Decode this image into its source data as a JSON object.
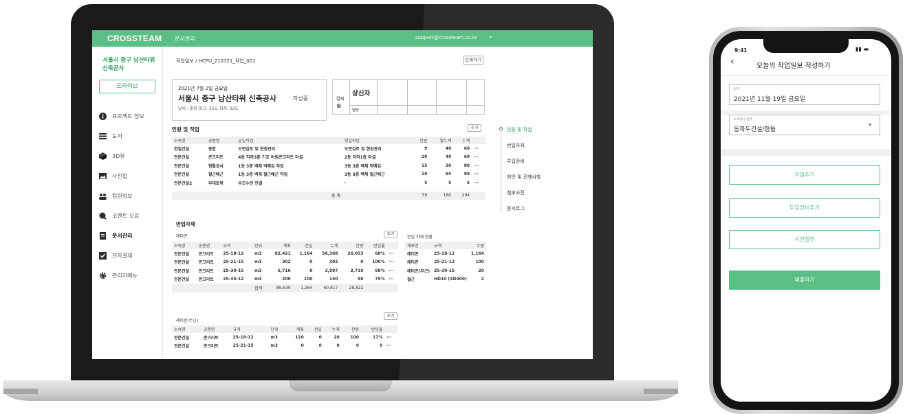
{
  "app": {
    "brand": "CROSSTEAM",
    "top_menu": "문서관리",
    "user_email": "support@crossteam.co.kr"
  },
  "sidebar": {
    "project_name": "서울시 중구 남산타워 신축공사",
    "drive_button": "드라이브",
    "items": [
      {
        "label": "프로젝트 정보",
        "icon": "info-icon"
      },
      {
        "label": "도서",
        "icon": "list-icon"
      },
      {
        "label": "3D뷰",
        "icon": "cube-icon"
      },
      {
        "label": "사진첩",
        "icon": "image-icon"
      },
      {
        "label": "팀원정보",
        "icon": "team-icon"
      },
      {
        "label": "코멘트 모음",
        "icon": "comment-icon"
      },
      {
        "label": "문서관리",
        "icon": "document-icon"
      },
      {
        "label": "전자결재",
        "icon": "approval-icon"
      },
      {
        "label": "관리자메뉴",
        "icon": "gear-icon"
      }
    ]
  },
  "main": {
    "breadcrumb": "작업일보 / HCPU_210321_작업_001",
    "print_button": "인쇄하기",
    "report": {
      "date": "2021년 7월 2일 금요일",
      "title": "서울시 중구 남산타워 신축공사",
      "status": "작성중",
      "weather": "날씨 : 맑음 최고: 35도 최저: 22도"
    },
    "approval": {
      "label": "결재",
      "submitter": "상신자",
      "assignee": "담당"
    },
    "workforce": {
      "title": "인원 및 작업",
      "add_button": "추가",
      "headers": [
        "소속명",
        "공종명",
        "금일작업",
        "명일작업",
        "인원",
        "월누계",
        "누계"
      ],
      "rows": [
        [
          "한일건설",
          "종합",
          "도면검토 및 현장관리",
          "도면검토 및 현장관리",
          "9",
          "40",
          "60"
        ],
        [
          "전문건설",
          "콘크리트",
          "4동 지하3층 기초 버림콘크리트 타설",
          "2동 지하1층 타설",
          "20",
          "40",
          "60"
        ],
        [
          "전문건설",
          "형틀공사",
          "1동 3층 벽체 먹매김 작업",
          "3동 3층 벽체 먹매김",
          "15",
          "30",
          "80"
        ],
        [
          "전문건설",
          "철근배근",
          "1동 3층 벽체 철근배근 작업",
          "3동 3층 벽체 철근배근",
          "10",
          "65",
          "89"
        ],
        [
          "전문건설2",
          "부대토목",
          "우오수관 연결",
          "-",
          "5",
          "5",
          "5"
        ]
      ],
      "total_label": "총 계",
      "totals": [
        "59",
        "180",
        "294"
      ],
      "more": "···"
    },
    "materials": {
      "title": "반입자재",
      "remicon": {
        "title": "레미콘",
        "add_button": "추가",
        "headers": [
          "소속명",
          "공종명",
          "규격",
          "단위",
          "계획",
          "전일",
          "누계",
          "잔량",
          "반입율"
        ],
        "rows": [
          [
            "전문건설",
            "콘크리트",
            "25-18-12",
            "m3",
            "82,421",
            "1,164",
            "56,368",
            "26,053",
            "68%"
          ],
          [
            "전문건설",
            "콘크리트",
            "25-21-15",
            "m3",
            "302",
            "0",
            "302",
            "0",
            "100%"
          ],
          [
            "전문건설",
            "콘크리트",
            "25-30-15",
            "m3",
            "6,716",
            "0",
            "3,997",
            "2,719",
            "68%"
          ],
          [
            "전문건설",
            "콘크리트",
            "25-35-12",
            "m3",
            "200",
            "100",
            "150",
            "50",
            "75%"
          ]
        ],
        "total_label": "합계",
        "totals": [
          "89,639",
          "1,264",
          "60,817",
          "28,822"
        ]
      },
      "prev_day": {
        "title": "전일 자재 현황",
        "headers": [
          "재료명",
          "규격",
          "수량"
        ],
        "rows": [
          [
            "레미콘",
            "25-18-12",
            "1,164"
          ],
          [
            "레미콘",
            "25-21-12",
            "100"
          ],
          [
            "레미콘(무근)",
            "25-30-15",
            "20"
          ],
          [
            "철근",
            "HD10 (SD400)",
            "2"
          ]
        ]
      },
      "remicon_plain": {
        "title": "레미콘(무근)",
        "add_button": "추가",
        "headers": [
          "소속명",
          "공종명",
          "규격",
          "단위",
          "계획",
          "전일",
          "누계",
          "잔량",
          "반입율"
        ],
        "rows": [
          [
            "전문건설",
            "콘크리트",
            "25-18-12",
            "m3",
            "120",
            "0",
            "20",
            "100",
            "17%"
          ],
          [
            "전문건설",
            "콘크리트",
            "25-21-15",
            "m3",
            "0",
            "0",
            "0",
            "0",
            "0"
          ]
        ]
      }
    },
    "toc": [
      "인원 및 작업",
      "반입자재",
      "투입장비",
      "현안 및 진행사항",
      "첨부사진",
      "문서로그"
    ]
  },
  "phone": {
    "time": "9:41",
    "title": "오늘의 작업일보 작성하기",
    "date_label": "일자",
    "date_value": "2021년 11월 19일 금요일",
    "company_label": "소속명/공종명",
    "company_value": "동파두건설/형틀",
    "buttons": [
      "작업추가",
      "투입장비추가",
      "사진첨부"
    ],
    "submit": "제출하기"
  },
  "colors": {
    "accent": "#5bbf85",
    "accent_dark": "#2f9a5c"
  }
}
